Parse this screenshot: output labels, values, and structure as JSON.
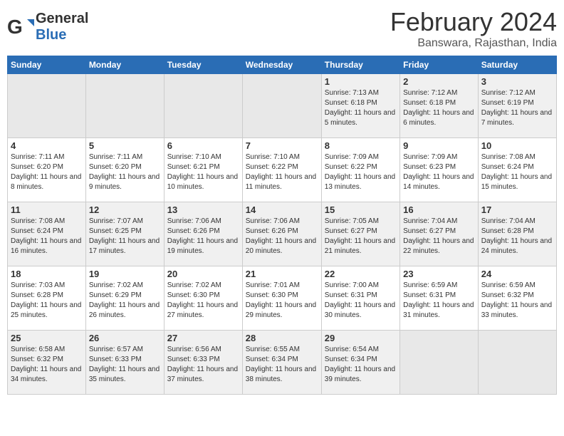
{
  "header": {
    "logo_general": "General",
    "logo_blue": "Blue",
    "main_title": "February 2024",
    "subtitle": "Banswara, Rajasthan, India"
  },
  "days_of_week": [
    "Sunday",
    "Monday",
    "Tuesday",
    "Wednesday",
    "Thursday",
    "Friday",
    "Saturday"
  ],
  "weeks": [
    [
      {
        "day": "",
        "empty": true
      },
      {
        "day": "",
        "empty": true
      },
      {
        "day": "",
        "empty": true
      },
      {
        "day": "",
        "empty": true
      },
      {
        "day": "1",
        "sunrise": "7:13 AM",
        "sunset": "6:18 PM",
        "daylight": "11 hours and 5 minutes."
      },
      {
        "day": "2",
        "sunrise": "7:12 AM",
        "sunset": "6:18 PM",
        "daylight": "11 hours and 6 minutes."
      },
      {
        "day": "3",
        "sunrise": "7:12 AM",
        "sunset": "6:19 PM",
        "daylight": "11 hours and 7 minutes."
      }
    ],
    [
      {
        "day": "4",
        "sunrise": "7:11 AM",
        "sunset": "6:20 PM",
        "daylight": "11 hours and 8 minutes."
      },
      {
        "day": "5",
        "sunrise": "7:11 AM",
        "sunset": "6:20 PM",
        "daylight": "11 hours and 9 minutes."
      },
      {
        "day": "6",
        "sunrise": "7:10 AM",
        "sunset": "6:21 PM",
        "daylight": "11 hours and 10 minutes."
      },
      {
        "day": "7",
        "sunrise": "7:10 AM",
        "sunset": "6:22 PM",
        "daylight": "11 hours and 11 minutes."
      },
      {
        "day": "8",
        "sunrise": "7:09 AM",
        "sunset": "6:22 PM",
        "daylight": "11 hours and 13 minutes."
      },
      {
        "day": "9",
        "sunrise": "7:09 AM",
        "sunset": "6:23 PM",
        "daylight": "11 hours and 14 minutes."
      },
      {
        "day": "10",
        "sunrise": "7:08 AM",
        "sunset": "6:24 PM",
        "daylight": "11 hours and 15 minutes."
      }
    ],
    [
      {
        "day": "11",
        "sunrise": "7:08 AM",
        "sunset": "6:24 PM",
        "daylight": "11 hours and 16 minutes."
      },
      {
        "day": "12",
        "sunrise": "7:07 AM",
        "sunset": "6:25 PM",
        "daylight": "11 hours and 17 minutes."
      },
      {
        "day": "13",
        "sunrise": "7:06 AM",
        "sunset": "6:26 PM",
        "daylight": "11 hours and 19 minutes."
      },
      {
        "day": "14",
        "sunrise": "7:06 AM",
        "sunset": "6:26 PM",
        "daylight": "11 hours and 20 minutes."
      },
      {
        "day": "15",
        "sunrise": "7:05 AM",
        "sunset": "6:27 PM",
        "daylight": "11 hours and 21 minutes."
      },
      {
        "day": "16",
        "sunrise": "7:04 AM",
        "sunset": "6:27 PM",
        "daylight": "11 hours and 22 minutes."
      },
      {
        "day": "17",
        "sunrise": "7:04 AM",
        "sunset": "6:28 PM",
        "daylight": "11 hours and 24 minutes."
      }
    ],
    [
      {
        "day": "18",
        "sunrise": "7:03 AM",
        "sunset": "6:28 PM",
        "daylight": "11 hours and 25 minutes."
      },
      {
        "day": "19",
        "sunrise": "7:02 AM",
        "sunset": "6:29 PM",
        "daylight": "11 hours and 26 minutes."
      },
      {
        "day": "20",
        "sunrise": "7:02 AM",
        "sunset": "6:30 PM",
        "daylight": "11 hours and 27 minutes."
      },
      {
        "day": "21",
        "sunrise": "7:01 AM",
        "sunset": "6:30 PM",
        "daylight": "11 hours and 29 minutes."
      },
      {
        "day": "22",
        "sunrise": "7:00 AM",
        "sunset": "6:31 PM",
        "daylight": "11 hours and 30 minutes."
      },
      {
        "day": "23",
        "sunrise": "6:59 AM",
        "sunset": "6:31 PM",
        "daylight": "11 hours and 31 minutes."
      },
      {
        "day": "24",
        "sunrise": "6:59 AM",
        "sunset": "6:32 PM",
        "daylight": "11 hours and 33 minutes."
      }
    ],
    [
      {
        "day": "25",
        "sunrise": "6:58 AM",
        "sunset": "6:32 PM",
        "daylight": "11 hours and 34 minutes."
      },
      {
        "day": "26",
        "sunrise": "6:57 AM",
        "sunset": "6:33 PM",
        "daylight": "11 hours and 35 minutes."
      },
      {
        "day": "27",
        "sunrise": "6:56 AM",
        "sunset": "6:33 PM",
        "daylight": "11 hours and 37 minutes."
      },
      {
        "day": "28",
        "sunrise": "6:55 AM",
        "sunset": "6:34 PM",
        "daylight": "11 hours and 38 minutes."
      },
      {
        "day": "29",
        "sunrise": "6:54 AM",
        "sunset": "6:34 PM",
        "daylight": "11 hours and 39 minutes."
      },
      {
        "day": "",
        "empty": true
      },
      {
        "day": "",
        "empty": true
      }
    ]
  ]
}
